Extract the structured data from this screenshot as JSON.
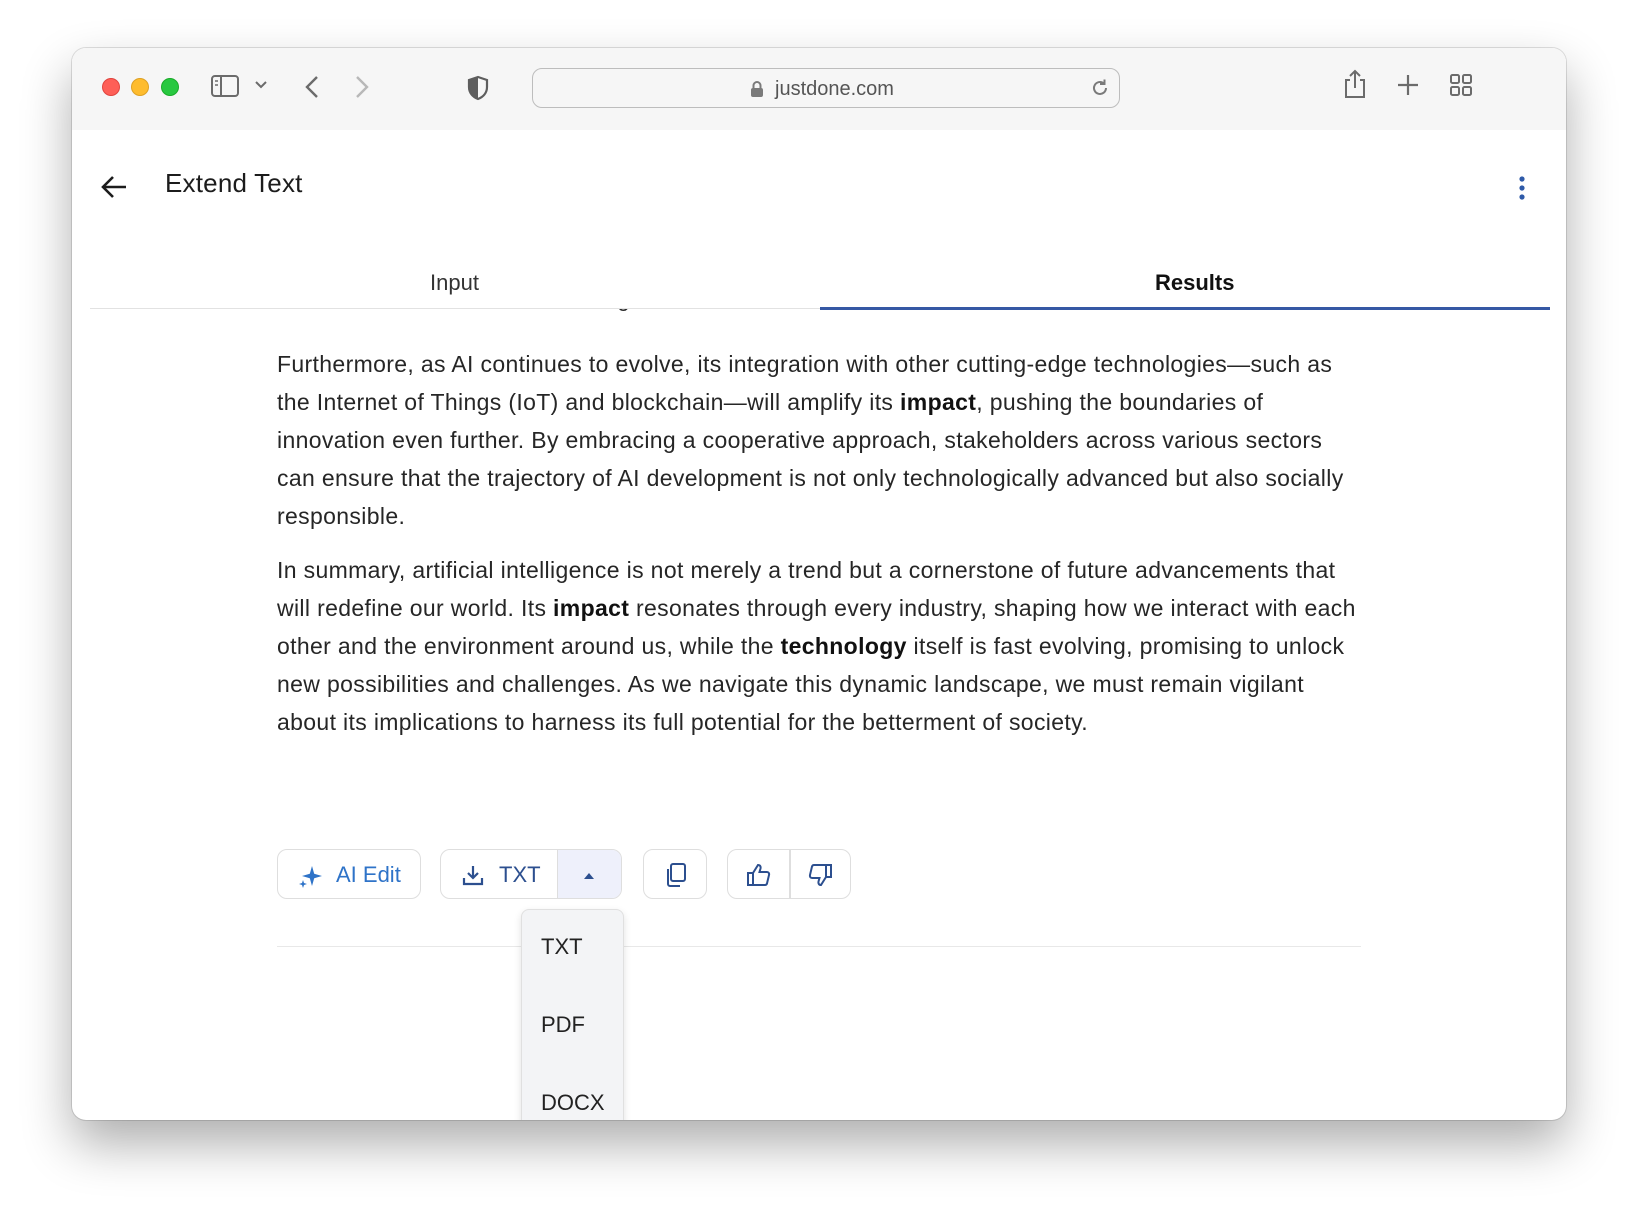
{
  "browser": {
    "url": "justdone.com"
  },
  "app": {
    "title": "Extend Text"
  },
  "tabs": [
    {
      "label": "Input",
      "active": false
    },
    {
      "label": "Results",
      "active": true
    }
  ],
  "content": {
    "clipped_line": "automation, and the fairness of algorithms will demand our attention and action.",
    "paragraph1": {
      "a": "Furthermore, as AI continues to evolve, its integration with other cutting-edge technologies—such as the Internet of Things (IoT) and blockchain—will amplify its ",
      "b": "impact",
      "c": ", pushing the boundaries of innovation even further. By embracing a cooperative approach, stakeholders across various sectors can ensure that the trajectory of AI development is not only technologically advanced but also socially responsible."
    },
    "paragraph2": {
      "a": "In summary, artificial intelligence is not merely a trend but a cornerstone of future advancements that will redefine our world. Its ",
      "b": "impact",
      "c": " resonates through every industry, shaping how we interact with each other and the environment around us, while the ",
      "d": "technology",
      "e": " itself is fast evolving, promising to unlock new possibilities and challenges. As we navigate this dynamic landscape, we must remain vigilant about its implications to harness its full potential for the betterment of society."
    }
  },
  "actions": {
    "ai_edit_label": "AI Edit",
    "download_label": "TXT"
  },
  "download_menu": {
    "items": [
      "TXT",
      "PDF",
      "DOCX"
    ]
  },
  "colors": {
    "accent_blue": "#2e73c8",
    "tab_indicator": "#3558a4",
    "dropdown_bg": "#f3f4f6"
  }
}
